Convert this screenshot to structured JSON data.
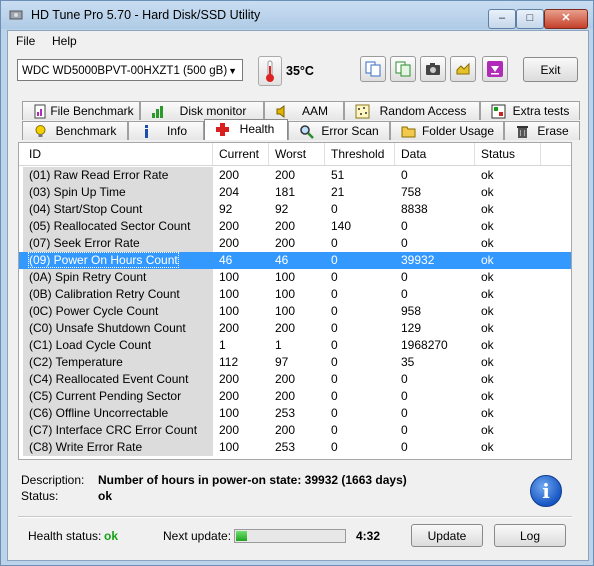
{
  "window": {
    "title": "HD Tune Pro 5.70 - Hard Disk/SSD Utility",
    "minimize": "–",
    "maximize": "□",
    "close": "✕"
  },
  "menu": {
    "file": "File",
    "help": "Help"
  },
  "toolbar": {
    "drive": "WDC WD5000BPVT-00HXZT1 (500 gB)",
    "temperature": "35°C",
    "exit": "Exit"
  },
  "tabs_top": [
    {
      "label": "File Benchmark",
      "icon": "file-benchmark-icon"
    },
    {
      "label": "Disk monitor",
      "icon": "disk-monitor-icon"
    },
    {
      "label": "AAM",
      "icon": "speaker-icon"
    },
    {
      "label": "Random Access",
      "icon": "random-access-icon"
    },
    {
      "label": "Extra tests",
      "icon": "extra-tests-icon"
    }
  ],
  "tabs_bottom": [
    {
      "label": "Benchmark",
      "icon": "lightbulb-icon"
    },
    {
      "label": "Info",
      "icon": "info-icon"
    },
    {
      "label": "Health",
      "icon": "health-cross-icon"
    },
    {
      "label": "Error Scan",
      "icon": "magnifier-icon"
    },
    {
      "label": "Folder Usage",
      "icon": "folder-icon"
    },
    {
      "label": "Erase",
      "icon": "trash-icon"
    }
  ],
  "table": {
    "headers": [
      "ID",
      "Current",
      "Worst",
      "Threshold",
      "Data",
      "Status"
    ],
    "selected_index": 5,
    "rows": [
      [
        "(01) Raw Read Error Rate",
        "200",
        "200",
        "51",
        "0",
        "ok"
      ],
      [
        "(03) Spin Up Time",
        "204",
        "181",
        "21",
        "758",
        "ok"
      ],
      [
        "(04) Start/Stop Count",
        "92",
        "92",
        "0",
        "8838",
        "ok"
      ],
      [
        "(05) Reallocated Sector Count",
        "200",
        "200",
        "140",
        "0",
        "ok"
      ],
      [
        "(07) Seek Error Rate",
        "200",
        "200",
        "0",
        "0",
        "ok"
      ],
      [
        "(09) Power On Hours Count",
        "46",
        "46",
        "0",
        "39932",
        "ok"
      ],
      [
        "(0A) Spin Retry Count",
        "100",
        "100",
        "0",
        "0",
        "ok"
      ],
      [
        "(0B) Calibration Retry Count",
        "100",
        "100",
        "0",
        "0",
        "ok"
      ],
      [
        "(0C) Power Cycle Count",
        "100",
        "100",
        "0",
        "958",
        "ok"
      ],
      [
        "(C0) Unsafe Shutdown Count",
        "200",
        "200",
        "0",
        "129",
        "ok"
      ],
      [
        "(C1) Load Cycle Count",
        "1",
        "1",
        "0",
        "1968270",
        "ok"
      ],
      [
        "(C2) Temperature",
        "112",
        "97",
        "0",
        "35",
        "ok"
      ],
      [
        "(C4) Reallocated Event Count",
        "200",
        "200",
        "0",
        "0",
        "ok"
      ],
      [
        "(C5) Current Pending Sector",
        "200",
        "200",
        "0",
        "0",
        "ok"
      ],
      [
        "(C6) Offline Uncorrectable",
        "100",
        "253",
        "0",
        "0",
        "ok"
      ],
      [
        "(C7) Interface CRC Error Count",
        "200",
        "200",
        "0",
        "0",
        "ok"
      ],
      [
        "(C8) Write Error Rate",
        "100",
        "253",
        "0",
        "0",
        "ok"
      ]
    ]
  },
  "description": {
    "description_label": "Description:",
    "description_value": "Number of hours in power-on state: 39932 (1663 days)",
    "status_label": "Status:",
    "status_value": "ok"
  },
  "statusbar": {
    "health_label": "Health status:",
    "health_value": "ok",
    "next_update_label": "Next update:",
    "progress_fraction": 0.1,
    "time": "4:32",
    "update_button": "Update",
    "log_button": "Log"
  },
  "colors": {
    "selection": "#3399ff",
    "ok_green": "#16a116"
  }
}
